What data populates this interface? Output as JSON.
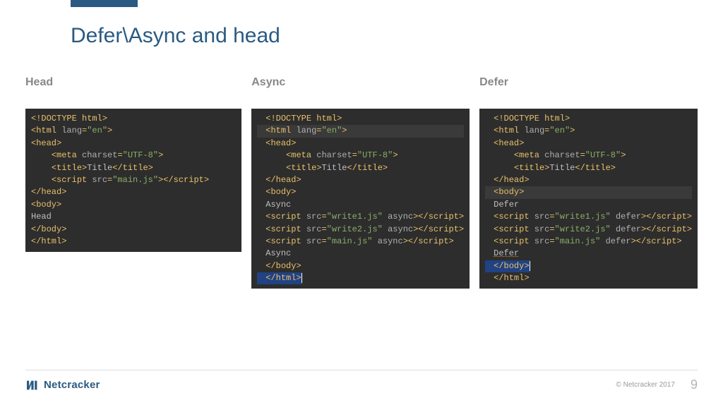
{
  "slide": {
    "title": "Defer\\Async and head"
  },
  "columns": {
    "head": {
      "label": "Head",
      "code_lines": [
        [
          {
            "c": "tag",
            "t": "<!DOCTYPE html>"
          }
        ],
        [
          {
            "c": "tag",
            "t": "<html "
          },
          {
            "c": "attr",
            "t": "lang"
          },
          {
            "c": "tag",
            "t": "="
          },
          {
            "c": "str",
            "t": "\"en\""
          },
          {
            "c": "tag",
            "t": ">"
          }
        ],
        [
          {
            "c": "tag",
            "t": "<head>"
          }
        ],
        [
          {
            "c": "txt",
            "t": "    "
          },
          {
            "c": "tag",
            "t": "<meta "
          },
          {
            "c": "attr",
            "t": "charset"
          },
          {
            "c": "tag",
            "t": "="
          },
          {
            "c": "str",
            "t": "\"UTF-8\""
          },
          {
            "c": "tag",
            "t": ">"
          }
        ],
        [
          {
            "c": "txt",
            "t": "    "
          },
          {
            "c": "tag",
            "t": "<title>"
          },
          {
            "c": "txt",
            "t": "Title"
          },
          {
            "c": "tag",
            "t": "</title>"
          }
        ],
        [
          {
            "c": "txt",
            "t": "    "
          },
          {
            "c": "tag",
            "t": "<script "
          },
          {
            "c": "attr",
            "t": "src"
          },
          {
            "c": "tag",
            "t": "="
          },
          {
            "c": "str",
            "t": "\"main.js\""
          },
          {
            "c": "tag",
            "t": "></​script>"
          }
        ],
        [
          {
            "c": "tag",
            "t": "</head>"
          }
        ],
        [
          {
            "c": "tag",
            "t": "<body>"
          }
        ],
        [
          {
            "c": "txt",
            "t": "Head"
          }
        ],
        [
          {
            "c": "tag",
            "t": "</body>"
          }
        ],
        [
          {
            "c": "tag",
            "t": "</html>"
          }
        ]
      ]
    },
    "async": {
      "label": "Async",
      "code_lines": [
        [
          {
            "c": "tag",
            "t": "<!DOCTYPE html>"
          }
        ],
        [
          {
            "c": "tag",
            "t": "<html "
          },
          {
            "c": "attr",
            "t": "lang"
          },
          {
            "c": "tag",
            "t": "="
          },
          {
            "c": "str",
            "t": "\"en\""
          },
          {
            "c": "tag",
            "t": ">"
          }
        ],
        [
          {
            "c": "tag",
            "t": "<head>"
          }
        ],
        [
          {
            "c": "txt",
            "t": "    "
          },
          {
            "c": "tag",
            "t": "<meta "
          },
          {
            "c": "attr",
            "t": "charset"
          },
          {
            "c": "tag",
            "t": "="
          },
          {
            "c": "str",
            "t": "\"UTF-8\""
          },
          {
            "c": "tag",
            "t": ">"
          }
        ],
        [
          {
            "c": "txt",
            "t": "    "
          },
          {
            "c": "tag",
            "t": "<title>"
          },
          {
            "c": "txt",
            "t": "Title"
          },
          {
            "c": "tag",
            "t": "</title>"
          }
        ],
        [
          {
            "c": "tag",
            "t": "</head>"
          }
        ],
        [
          {
            "c": "tag",
            "t": "<body>"
          }
        ],
        [
          {
            "c": "txt",
            "t": "Async"
          }
        ],
        [
          {
            "c": "tag",
            "t": "<script "
          },
          {
            "c": "attr",
            "t": "src"
          },
          {
            "c": "tag",
            "t": "="
          },
          {
            "c": "str",
            "t": "\"write1.js\""
          },
          {
            "c": "tag",
            "t": " "
          },
          {
            "c": "attr",
            "t": "async"
          },
          {
            "c": "tag",
            "t": "></​script>"
          }
        ],
        [
          {
            "c": "tag",
            "t": "<script "
          },
          {
            "c": "attr",
            "t": "src"
          },
          {
            "c": "tag",
            "t": "="
          },
          {
            "c": "str",
            "t": "\"write2.js\""
          },
          {
            "c": "tag",
            "t": " "
          },
          {
            "c": "attr",
            "t": "async"
          },
          {
            "c": "tag",
            "t": "></​script>"
          }
        ],
        [
          {
            "c": "tag",
            "t": "<script "
          },
          {
            "c": "attr",
            "t": "src"
          },
          {
            "c": "tag",
            "t": "="
          },
          {
            "c": "str",
            "t": "\"main.js\""
          },
          {
            "c": "tag",
            "t": " "
          },
          {
            "c": "attr",
            "t": "async"
          },
          {
            "c": "tag",
            "t": "></​script>"
          }
        ],
        [
          {
            "c": "txt",
            "t": "Async"
          }
        ],
        [
          {
            "c": "tag",
            "t": "</body>"
          }
        ],
        [
          {
            "c": "tag",
            "t": "</html>"
          }
        ]
      ],
      "highlight": [
        1
      ],
      "caret_line": 13
    },
    "defer": {
      "label": "Defer",
      "code_lines": [
        [
          {
            "c": "tag",
            "t": "<!DOCTYPE html>"
          }
        ],
        [
          {
            "c": "tag",
            "t": "<html "
          },
          {
            "c": "attr",
            "t": "lang"
          },
          {
            "c": "tag",
            "t": "="
          },
          {
            "c": "str",
            "t": "\"en\""
          },
          {
            "c": "tag",
            "t": ">"
          }
        ],
        [
          {
            "c": "tag",
            "t": "<head>"
          }
        ],
        [
          {
            "c": "txt",
            "t": "    "
          },
          {
            "c": "tag",
            "t": "<meta "
          },
          {
            "c": "attr",
            "t": "charset"
          },
          {
            "c": "tag",
            "t": "="
          },
          {
            "c": "str",
            "t": "\"UTF-8\""
          },
          {
            "c": "tag",
            "t": ">"
          }
        ],
        [
          {
            "c": "txt",
            "t": "    "
          },
          {
            "c": "tag",
            "t": "<title>"
          },
          {
            "c": "txt",
            "t": "Title"
          },
          {
            "c": "tag",
            "t": "</title>"
          }
        ],
        [
          {
            "c": "tag",
            "t": "</head>"
          }
        ],
        [
          {
            "c": "tag",
            "t": "<body>"
          }
        ],
        [
          {
            "c": "txt",
            "t": "Defer"
          }
        ],
        [
          {
            "c": "tag",
            "t": "<script "
          },
          {
            "c": "attr",
            "t": "src"
          },
          {
            "c": "tag",
            "t": "="
          },
          {
            "c": "str",
            "t": "\"write1.js\""
          },
          {
            "c": "tag",
            "t": " "
          },
          {
            "c": "attr",
            "t": "defer"
          },
          {
            "c": "tag",
            "t": "></​script>"
          }
        ],
        [
          {
            "c": "tag",
            "t": "<script "
          },
          {
            "c": "attr",
            "t": "src"
          },
          {
            "c": "tag",
            "t": "="
          },
          {
            "c": "str",
            "t": "\"write2.js\""
          },
          {
            "c": "tag",
            "t": " "
          },
          {
            "c": "attr",
            "t": "defer"
          },
          {
            "c": "tag",
            "t": "></​script>"
          }
        ],
        [
          {
            "c": "tag",
            "t": "<script "
          },
          {
            "c": "attr",
            "t": "src"
          },
          {
            "c": "tag",
            "t": "="
          },
          {
            "c": "str",
            "t": "\"main.js\""
          },
          {
            "c": "tag",
            "t": " "
          },
          {
            "c": "attr",
            "t": "defer"
          },
          {
            "c": "tag",
            "t": "></​script>"
          }
        ],
        [
          {
            "c": "txt",
            "t": "Defer",
            "squiggle": true
          }
        ],
        [
          {
            "c": "tag",
            "t": "</body>"
          }
        ],
        [
          {
            "c": "tag",
            "t": "</html>"
          }
        ]
      ],
      "highlight": [
        6
      ],
      "caret_line": 12
    }
  },
  "footer": {
    "brand": "Netcracker",
    "copyright": "© Netcracker 2017",
    "page_number": "9"
  }
}
